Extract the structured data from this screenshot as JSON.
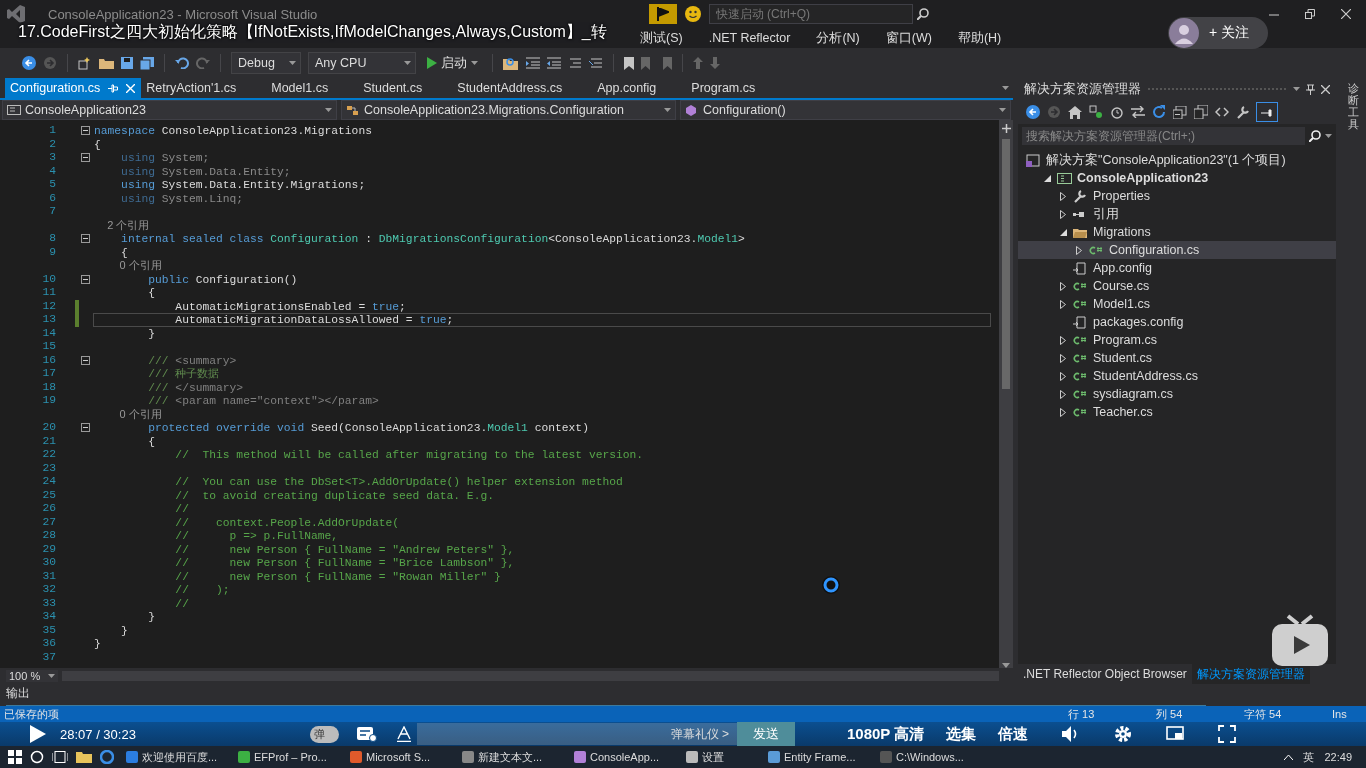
{
  "window": {
    "title": "ConsoleApplication23 - Microsoft Visual Studio",
    "quick_launch": {
      "placeholder": "快速启动 (Ctrl+Q)"
    }
  },
  "video": {
    "title": "17.CodeFirst之四大初始化策略【IfNotExists,IfModelChanges,Always,Custom】_转",
    "follow_button": "+ 关注"
  },
  "menu": [
    "测试(S)",
    ".NET Reflector",
    "分析(N)",
    "窗口(W)",
    "帮助(H)"
  ],
  "toolbar": {
    "configuration": "Debug",
    "platform": "Any CPU",
    "start_button": "启动"
  },
  "tabs": [
    {
      "label": "Configuration.cs",
      "selected": true,
      "pinned": true
    },
    {
      "label": "RetryAction'1.cs",
      "selected": false,
      "pinned": false
    },
    {
      "label": "Model1.cs",
      "selected": false,
      "pinned": false
    },
    {
      "label": "Student.cs",
      "selected": false,
      "pinned": false
    },
    {
      "label": "StudentAddress.cs",
      "selected": false,
      "pinned": false
    },
    {
      "label": "App.config",
      "selected": false,
      "pinned": false
    },
    {
      "label": "Program.cs",
      "selected": false,
      "pinned": false
    }
  ],
  "navigation": {
    "project": "ConsoleApplication23",
    "type": "ConsoleApplication23.Migrations.Configuration",
    "member": "Configuration()"
  },
  "editor": {
    "zoom": "100 %",
    "lines": [
      {
        "kind": "code",
        "number": "1",
        "fold": true,
        "changed": false,
        "current": false,
        "tokens": [
          {
            "kind": "kw",
            "text": "namespace"
          },
          {
            "kind": "txt",
            "text": " ConsoleApplication23.Migrations"
          }
        ]
      },
      {
        "kind": "code",
        "number": "2",
        "fold": false,
        "changed": false,
        "current": false,
        "tokens": [
          {
            "kind": "txt",
            "text": "{"
          }
        ]
      },
      {
        "kind": "code",
        "number": "3",
        "fold": true,
        "changed": false,
        "current": false,
        "tokens": [
          {
            "kind": "kwdim",
            "text": "    using"
          },
          {
            "kind": "dim",
            "text": " System;"
          }
        ]
      },
      {
        "kind": "code",
        "number": "4",
        "fold": false,
        "changed": false,
        "current": false,
        "tokens": [
          {
            "kind": "kwdim",
            "text": "    using"
          },
          {
            "kind": "dim",
            "text": " System.Data.Entity;"
          }
        ]
      },
      {
        "kind": "code",
        "number": "5",
        "fold": false,
        "changed": false,
        "current": false,
        "tokens": [
          {
            "kind": "kw",
            "text": "    using"
          },
          {
            "kind": "txt",
            "text": " System.Data.Entity.Migrations;"
          }
        ]
      },
      {
        "kind": "code",
        "number": "6",
        "fold": false,
        "changed": false,
        "current": false,
        "tokens": [
          {
            "kind": "kwdim",
            "text": "    using"
          },
          {
            "kind": "dim",
            "text": " System.Linq;"
          }
        ]
      },
      {
        "kind": "code",
        "number": "7",
        "fold": false,
        "changed": false,
        "current": false
      },
      {
        "kind": "lens",
        "text": "    2 个引用"
      },
      {
        "kind": "code",
        "number": "8",
        "fold": true,
        "changed": false,
        "current": false,
        "tokens": [
          {
            "kind": "kw",
            "text": "    internal sealed class "
          },
          {
            "kind": "type",
            "text": "Configuration"
          },
          {
            "kind": "txt",
            "text": " : "
          },
          {
            "kind": "type",
            "text": "DbMigrationsConfiguration"
          },
          {
            "kind": "txt",
            "text": "<ConsoleApplication23."
          },
          {
            "kind": "type",
            "text": "Model1"
          },
          {
            "kind": "txt",
            "text": ">"
          }
        ]
      },
      {
        "kind": "code",
        "number": "9",
        "fold": false,
        "changed": false,
        "current": false,
        "tokens": [
          {
            "kind": "txt",
            "text": "    {"
          }
        ]
      },
      {
        "kind": "lens",
        "text": "        0 个引用"
      },
      {
        "kind": "code",
        "number": "10",
        "fold": true,
        "changed": false,
        "current": false,
        "tokens": [
          {
            "kind": "kw",
            "text": "        public"
          },
          {
            "kind": "txt",
            "text": " Configuration()"
          }
        ]
      },
      {
        "kind": "code",
        "number": "11",
        "fold": false,
        "changed": false,
        "current": false,
        "tokens": [
          {
            "kind": "txt",
            "text": "        {"
          }
        ]
      },
      {
        "kind": "code",
        "number": "12",
        "fold": false,
        "changed": true,
        "current": false,
        "tokens": [
          {
            "kind": "txt",
            "text": "            AutomaticMigrationsEnabled = "
          },
          {
            "kind": "kw",
            "text": "true"
          },
          {
            "kind": "txt",
            "text": ";"
          }
        ]
      },
      {
        "kind": "code",
        "number": "13",
        "fold": false,
        "changed": true,
        "current": true,
        "tokens": [
          {
            "kind": "txt",
            "text": "            AutomaticMigrationDataLossAllowed = "
          },
          {
            "kind": "kw",
            "text": "true"
          },
          {
            "kind": "txt",
            "text": ";"
          }
        ]
      },
      {
        "kind": "code",
        "number": "14",
        "fold": false,
        "changed": false,
        "current": false,
        "tokens": [
          {
            "kind": "txt",
            "text": "        }"
          }
        ]
      },
      {
        "kind": "code",
        "number": "15",
        "fold": false,
        "changed": false,
        "current": false
      },
      {
        "kind": "code",
        "number": "16",
        "fold": true,
        "changed": false,
        "current": false,
        "tokens": [
          {
            "kind": "doc",
            "text": "        ///"
          },
          {
            "kind": "doctag",
            "text": " <summary>"
          }
        ]
      },
      {
        "kind": "code",
        "number": "17",
        "fold": false,
        "changed": false,
        "current": false,
        "tokens": [
          {
            "kind": "doc",
            "text": "        /// 种子数据"
          }
        ]
      },
      {
        "kind": "code",
        "number": "18",
        "fold": false,
        "changed": false,
        "current": false,
        "tokens": [
          {
            "kind": "doc",
            "text": "        ///"
          },
          {
            "kind": "doctag",
            "text": " </summary>"
          }
        ]
      },
      {
        "kind": "code",
        "number": "19",
        "fold": false,
        "changed": false,
        "current": false,
        "tokens": [
          {
            "kind": "doc",
            "text": "        ///"
          },
          {
            "kind": "doctag",
            "text": " <param name=\"context\"></param>"
          }
        ]
      },
      {
        "kind": "lens",
        "text": "        0 个引用"
      },
      {
        "kind": "code",
        "number": "20",
        "fold": true,
        "changed": false,
        "current": false,
        "tokens": [
          {
            "kind": "kw",
            "text": "        protected override void"
          },
          {
            "kind": "txt",
            "text": " Seed(ConsoleApplication23."
          },
          {
            "kind": "type",
            "text": "Model1"
          },
          {
            "kind": "txt",
            "text": " context)"
          }
        ]
      },
      {
        "kind": "code",
        "number": "21",
        "fold": false,
        "changed": false,
        "current": false,
        "tokens": [
          {
            "kind": "txt",
            "text": "        {"
          }
        ]
      },
      {
        "kind": "code",
        "number": "22",
        "fold": false,
        "changed": false,
        "current": false,
        "tokens": [
          {
            "kind": "cm",
            "text": "            //  This method will be called after migrating to the latest version."
          }
        ]
      },
      {
        "kind": "code",
        "number": "23",
        "fold": false,
        "changed": false,
        "current": false
      },
      {
        "kind": "code",
        "number": "24",
        "fold": false,
        "changed": false,
        "current": false,
        "tokens": [
          {
            "kind": "cm",
            "text": "            //  You can use the DbSet<T>.AddOrUpdate() helper extension method"
          }
        ]
      },
      {
        "kind": "code",
        "number": "25",
        "fold": false,
        "changed": false,
        "current": false,
        "tokens": [
          {
            "kind": "cm",
            "text": "            //  to avoid creating duplicate seed data. E.g."
          }
        ]
      },
      {
        "kind": "code",
        "number": "26",
        "fold": false,
        "changed": false,
        "current": false,
        "tokens": [
          {
            "kind": "cm",
            "text": "            //"
          }
        ]
      },
      {
        "kind": "code",
        "number": "27",
        "fold": false,
        "changed": false,
        "current": false,
        "tokens": [
          {
            "kind": "cm",
            "text": "            //    context.People.AddOrUpdate("
          }
        ]
      },
      {
        "kind": "code",
        "number": "28",
        "fold": false,
        "changed": false,
        "current": false,
        "tokens": [
          {
            "kind": "cm",
            "text": "            //      p => p.FullName,"
          }
        ]
      },
      {
        "kind": "code",
        "number": "29",
        "fold": false,
        "changed": false,
        "current": false,
        "tokens": [
          {
            "kind": "cm",
            "text": "            //      new Person { FullName = \"Andrew Peters\" },"
          }
        ]
      },
      {
        "kind": "code",
        "number": "30",
        "fold": false,
        "changed": false,
        "current": false,
        "tokens": [
          {
            "kind": "cm",
            "text": "            //      new Person { FullName = \"Brice Lambson\" },"
          }
        ]
      },
      {
        "kind": "code",
        "number": "31",
        "fold": false,
        "changed": false,
        "current": false,
        "tokens": [
          {
            "kind": "cm",
            "text": "            //      new Person { FullName = \"Rowan Miller\" }"
          }
        ]
      },
      {
        "kind": "code",
        "number": "32",
        "fold": false,
        "changed": false,
        "current": false,
        "tokens": [
          {
            "kind": "cm",
            "text": "            //    );"
          }
        ]
      },
      {
        "kind": "code",
        "number": "33",
        "fold": false,
        "changed": false,
        "current": false,
        "tokens": [
          {
            "kind": "cm",
            "text": "            //"
          }
        ]
      },
      {
        "kind": "code",
        "number": "34",
        "fold": false,
        "changed": false,
        "current": false,
        "tokens": [
          {
            "kind": "txt",
            "text": "        }"
          }
        ]
      },
      {
        "kind": "code",
        "number": "35",
        "fold": false,
        "changed": false,
        "current": false,
        "tokens": [
          {
            "kind": "txt",
            "text": "    }"
          }
        ]
      },
      {
        "kind": "code",
        "number": "36",
        "fold": false,
        "changed": false,
        "current": false,
        "tokens": [
          {
            "kind": "txt",
            "text": "}"
          }
        ]
      },
      {
        "kind": "code",
        "number": "37",
        "fold": false,
        "changed": false,
        "current": false
      }
    ]
  },
  "solution_explorer": {
    "title": "解决方案资源管理器",
    "search": {
      "placeholder": "搜索解决方案资源管理器(Ctrl+;)"
    },
    "tree": [
      {
        "label": "解决方案\"ConsoleApplication23\"(1 个项目)",
        "kind": "solution",
        "selected": false,
        "children": [
          {
            "label": "ConsoleApplication23",
            "kind": "project",
            "expanded": true,
            "selected": false,
            "children": [
              {
                "label": "Properties",
                "kind": "properties",
                "expanded": false,
                "selected": false
              },
              {
                "label": "引用",
                "kind": "references",
                "expanded": false,
                "selected": false
              },
              {
                "label": "Migrations",
                "kind": "folder",
                "expanded": true,
                "selected": false,
                "children": [
                  {
                    "label": "Configuration.cs",
                    "kind": "cs",
                    "expanded": false,
                    "selected": true
                  }
                ]
              },
              {
                "label": "App.config",
                "kind": "config",
                "selected": false
              },
              {
                "label": "Course.cs",
                "kind": "cs",
                "expanded": false,
                "selected": false
              },
              {
                "label": "Model1.cs",
                "kind": "cs",
                "expanded": false,
                "selected": false
              },
              {
                "label": "packages.config",
                "kind": "config",
                "selected": false
              },
              {
                "label": "Program.cs",
                "kind": "cs",
                "expanded": false,
                "selected": false
              },
              {
                "label": "Student.cs",
                "kind": "cs",
                "expanded": false,
                "selected": false
              },
              {
                "label": "StudentAddress.cs",
                "kind": "cs",
                "expanded": false,
                "selected": false
              },
              {
                "label": "sysdiagram.cs",
                "kind": "cs",
                "expanded": false,
                "selected": false
              },
              {
                "label": "Teacher.cs",
                "kind": "cs",
                "expanded": false,
                "selected": false
              }
            ]
          }
        ]
      }
    ],
    "bottom_tabs": [
      {
        "label": ".NET Reflector Object Browser",
        "selected": false
      },
      {
        "label": "解决方案资源管理器",
        "selected": true
      }
    ]
  },
  "side_rail": {
    "label": "诊断工具"
  },
  "output_panel": {
    "title": "输出"
  },
  "status_bar": {
    "message": "已保存的项",
    "items": [
      "行 13",
      "列 54",
      "字符 54",
      "Ins"
    ]
  },
  "player": {
    "time": "28:07 / 30:23",
    "danmaku_toggle": "弹",
    "danmaku_input": {
      "placeholder": "弹幕礼仪 >"
    },
    "send_button": "发送",
    "quality": "1080P 高清",
    "episodes": "选集",
    "speed": "倍速"
  },
  "taskbar": {
    "items": [
      "欢迎使用百度...",
      "EFProf – Pro...",
      "Microsoft S...",
      "新建文本文...",
      "ConsoleApp...",
      "设置",
      "Entity Frame...",
      "C:\\Windows..."
    ],
    "language": "英",
    "clock": "22:49"
  }
}
